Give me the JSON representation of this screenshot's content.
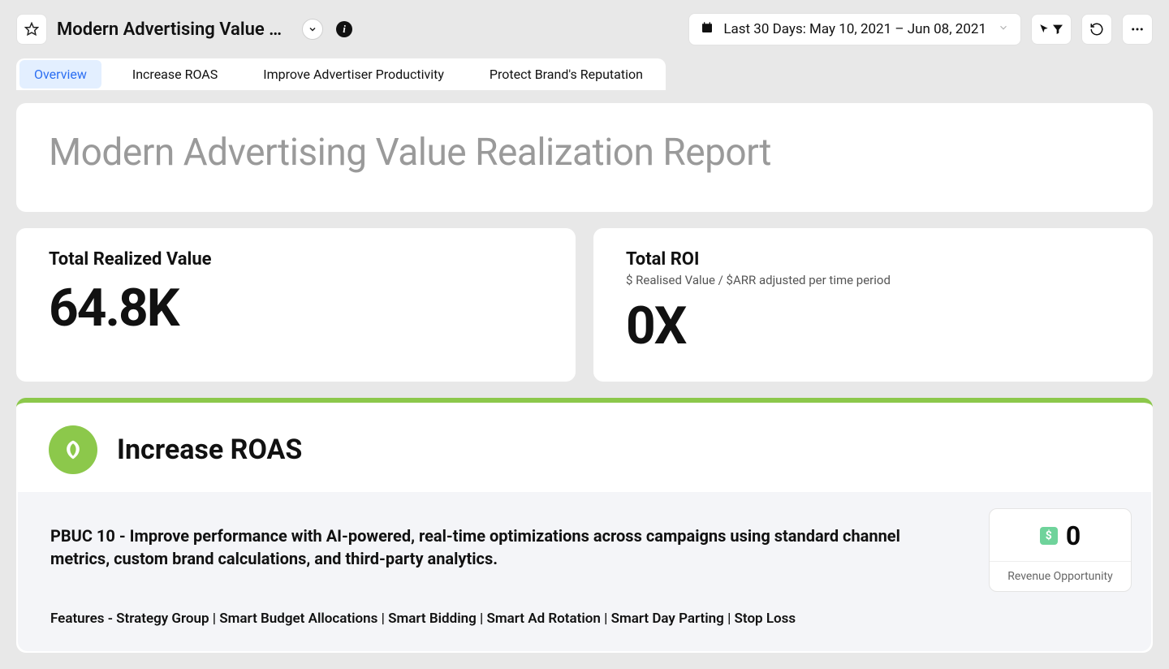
{
  "header": {
    "title_truncated": "Modern Advertising Value Realizati...",
    "date_range_label": "Last 30 Days: May 10, 2021 – Jun 08, 2021"
  },
  "tabs": {
    "active": "Overview",
    "items": [
      "Overview",
      "Increase ROAS",
      "Improve Advertiser Productivity",
      "Protect Brand's Reputation"
    ]
  },
  "hero": {
    "title": "Modern Advertising Value Realization Report"
  },
  "metrics": {
    "total_realized_value": {
      "label": "Total Realized Value",
      "value": "64.8K"
    },
    "total_roi": {
      "label": "Total ROI",
      "sub": "$ Realised Value / $ARR adjusted per time period",
      "value": "0X"
    }
  },
  "roas": {
    "heading": "Increase ROAS",
    "description": "PBUC 10 - Improve performance with AI-powered, real-time optimizations across campaigns using standard channel metrics, custom brand calculations, and third-party analytics.",
    "features_line": "Features - Strategy Group | Smart Budget Allocations | Smart Bidding | Smart Ad Rotation | Smart Day Parting | Stop Loss",
    "revenue_opportunity": {
      "value": "0",
      "label": "Revenue Opportunity"
    }
  }
}
